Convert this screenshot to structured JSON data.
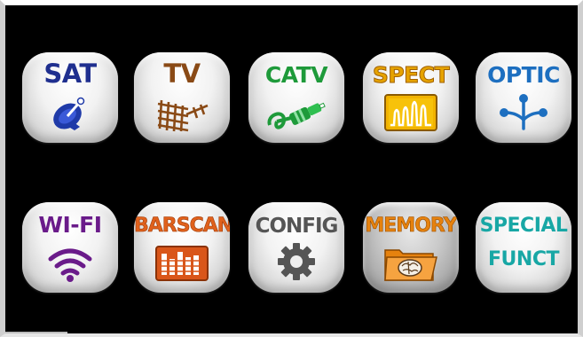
{
  "menu": {
    "tiles": [
      {
        "id": "sat",
        "label": "SAT",
        "color": "#1f2f8f",
        "icon": "satellite-dish-icon"
      },
      {
        "id": "tv",
        "label": "TV",
        "color": "#8a4a16",
        "icon": "tv-antenna-icon"
      },
      {
        "id": "catv",
        "label": "CATV",
        "color": "#1e9a3a",
        "icon": "coax-cable-icon"
      },
      {
        "id": "spect",
        "label": "SPECT",
        "color": "#e6a300",
        "icon": "spectrum-icon"
      },
      {
        "id": "optic",
        "label": "OPTIC",
        "color": "#1d6fc0",
        "icon": "optical-splitter-icon"
      },
      {
        "id": "wifi",
        "label": "WI-FI",
        "color": "#6a1b8a",
        "icon": "wifi-icon"
      },
      {
        "id": "barscan",
        "label": "BARSCAN",
        "color": "#e0611c",
        "icon": "barscan-bars-icon"
      },
      {
        "id": "config",
        "label": "CONFIG",
        "color": "#555555",
        "icon": "gear-icon"
      },
      {
        "id": "memory",
        "label": "MEMORY",
        "color": "#e6820e",
        "icon": "memory-folder-icon"
      },
      {
        "id": "special",
        "label": "SPECIAL",
        "label2": "FUNCT",
        "color": "#18a7a5",
        "icon": "special-functions-icon"
      }
    ],
    "selected": "memory"
  }
}
